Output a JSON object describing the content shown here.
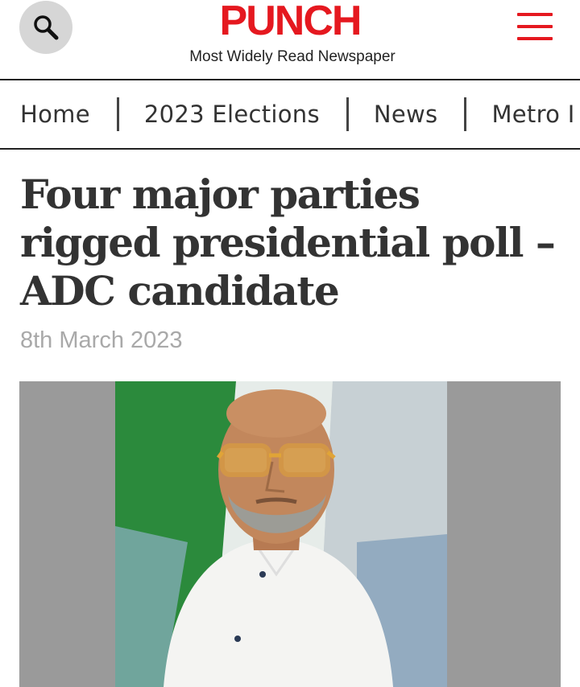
{
  "header": {
    "logo_text": "PUNCH",
    "tagline": "Most Widely Read Newspaper",
    "search_icon": "search-icon",
    "menu_icon": "hamburger-menu-icon",
    "brand_color": "#e5181f"
  },
  "nav": {
    "items": [
      {
        "label": "Home"
      },
      {
        "label": "2023 Elections"
      },
      {
        "label": "News"
      },
      {
        "label": "Metro I"
      }
    ]
  },
  "article": {
    "headline": "Four major parties rigged presidential poll – ADC candidate",
    "date": "8th March 2023",
    "image_subject": "portrait of a man in white shirt and yellow-framed glasses in front of a green-white flag"
  }
}
